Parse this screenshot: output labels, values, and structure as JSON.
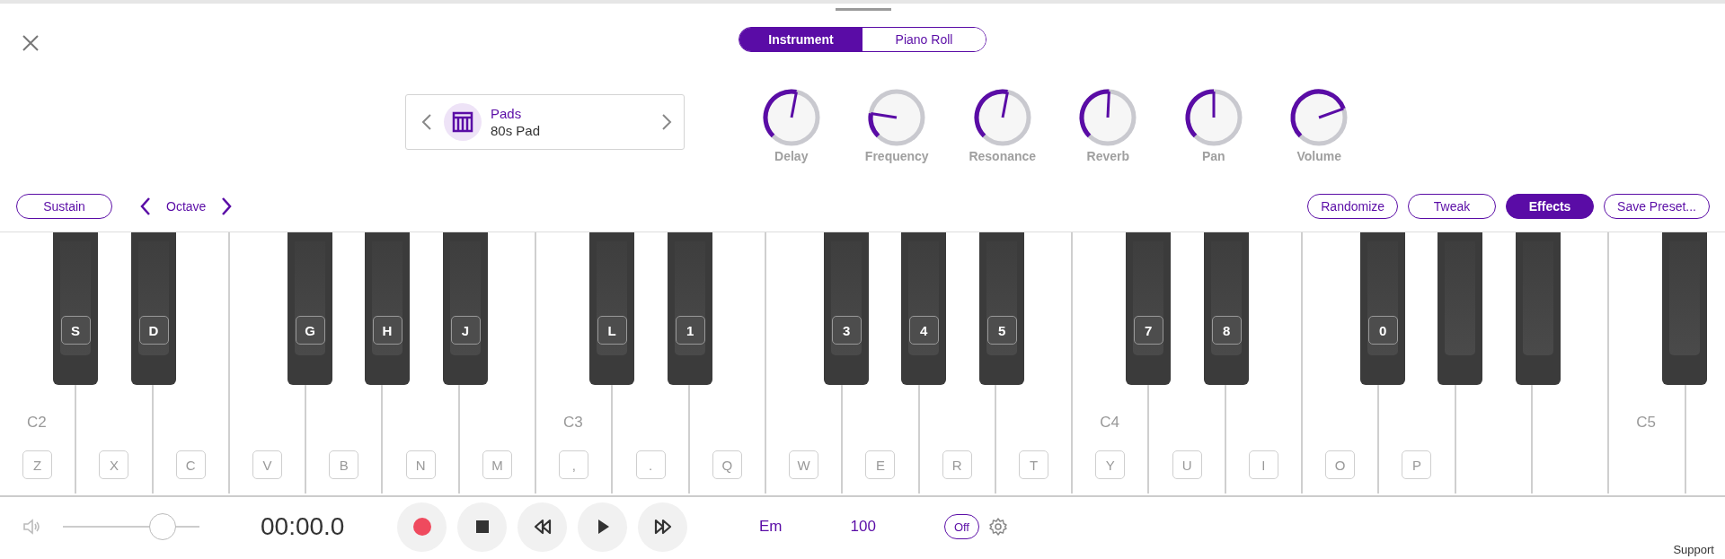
{
  "view_tabs": [
    {
      "label": "Instrument",
      "selected": true
    },
    {
      "label": "Piano Roll",
      "selected": false
    }
  ],
  "preset": {
    "category": "Pads",
    "name": "80s Pad"
  },
  "knobs": [
    {
      "label": "Delay"
    },
    {
      "label": "Frequency"
    },
    {
      "label": "Resonance"
    },
    {
      "label": "Reverb"
    },
    {
      "label": "Pan"
    },
    {
      "label": "Volume"
    }
  ],
  "sustain": {
    "label": "Sustain",
    "on": false
  },
  "octave": {
    "label": "Octave"
  },
  "actions": [
    {
      "label": "Randomize",
      "selected": false
    },
    {
      "label": "Tweak",
      "selected": false
    },
    {
      "label": "Effects",
      "selected": true
    },
    {
      "label": "Save Preset...",
      "selected": false
    }
  ],
  "octaves": [
    {
      "note": "C2",
      "white_keys": [
        "Z",
        "X",
        "C",
        "V",
        "B",
        "N",
        "M"
      ],
      "sharp_keys": [
        "S",
        "D",
        "G",
        "H",
        "J"
      ]
    },
    {
      "note": "C3",
      "white_keys": [
        ",",
        ".",
        "Q",
        "W",
        "E",
        "R",
        "T"
      ],
      "sharp_keys": [
        "L",
        "1",
        "3",
        "4",
        "5"
      ]
    },
    {
      "note": "C4",
      "white_keys": [
        "Y",
        "U",
        "I",
        "O",
        "P"
      ],
      "sharp_keys": [
        "7",
        "8",
        "0"
      ]
    },
    {
      "note": "C5"
    }
  ],
  "transport": {
    "volume": {
      "level": 0.73
    },
    "time": "00:00.0",
    "key": "Em",
    "tempo": "100",
    "metronome": {
      "label": "Off",
      "on": false
    }
  },
  "support": "Support"
}
